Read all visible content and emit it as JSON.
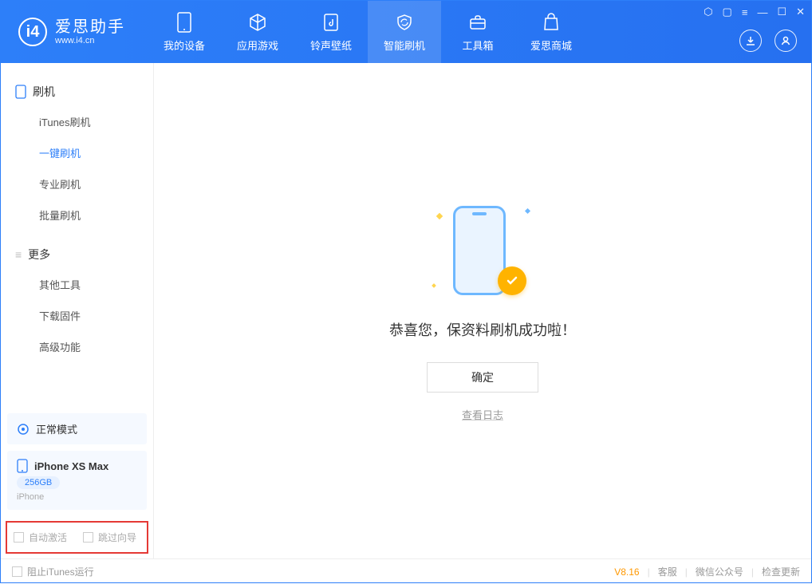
{
  "app": {
    "title": "爱思助手",
    "subtitle": "www.i4.cn"
  },
  "nav": {
    "tabs": [
      {
        "label": "我的设备"
      },
      {
        "label": "应用游戏"
      },
      {
        "label": "铃声壁纸"
      },
      {
        "label": "智能刷机"
      },
      {
        "label": "工具箱"
      },
      {
        "label": "爱思商城"
      }
    ]
  },
  "sidebar": {
    "group1": {
      "title": "刷机",
      "items": [
        "iTunes刷机",
        "一键刷机",
        "专业刷机",
        "批量刷机"
      ]
    },
    "group2": {
      "title": "更多",
      "items": [
        "其他工具",
        "下载固件",
        "高级功能"
      ]
    },
    "mode": "正常模式",
    "device": {
      "name": "iPhone XS Max",
      "storage": "256GB",
      "type": "iPhone"
    },
    "opts": {
      "auto_activate": "自动激活",
      "skip_guide": "跳过向导"
    }
  },
  "main": {
    "success_text": "恭喜您，保资料刷机成功啦！",
    "ok_button": "确定",
    "log_link": "查看日志"
  },
  "footer": {
    "block_itunes": "阻止iTunes运行",
    "version": "V8.16",
    "links": [
      "客服",
      "微信公众号",
      "检查更新"
    ]
  }
}
